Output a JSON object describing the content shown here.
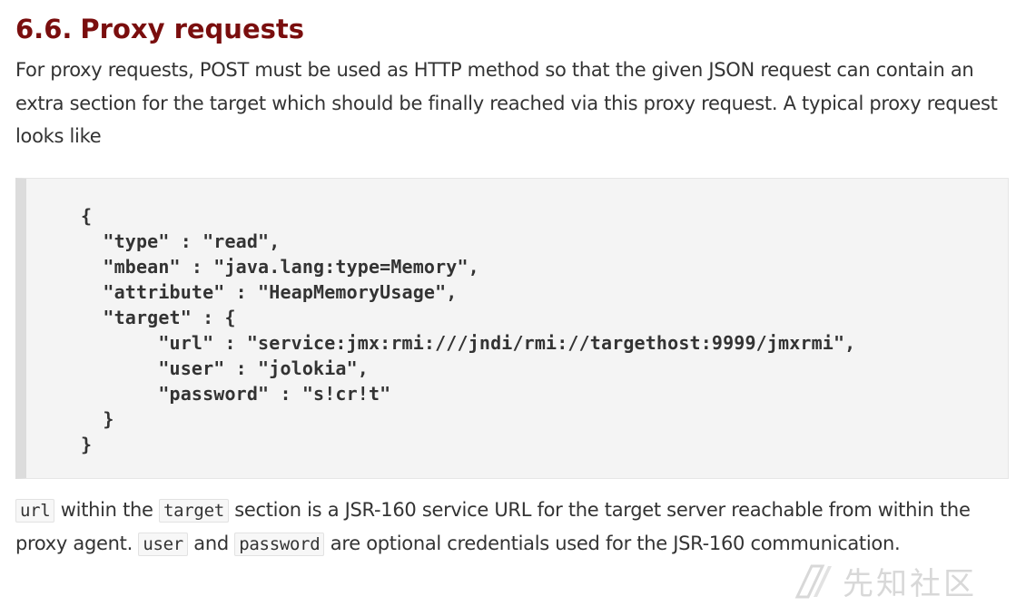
{
  "section": {
    "number": "6.6.",
    "title": "Proxy requests"
  },
  "intro": {
    "text": "For proxy requests, POST must be used as HTTP method so that the given JSON request can contain an extra section for the target which should be finally reached via this proxy request. A typical proxy request looks like"
  },
  "code_sample": {
    "lines": [
      "{",
      "  \"type\" : \"read\",",
      "  \"mbean\" : \"java.lang:type=Memory\",",
      "  \"attribute\" : \"HeapMemoryUsage\",",
      "  \"target\" : {",
      "       \"url\" : \"service:jmx:rmi:///jndi/rmi://targethost:9999/jmxrmi\",",
      "       \"user\" : \"jolokia\",",
      "       \"password\" : \"s!cr!t\"",
      "  }",
      "}"
    ]
  },
  "explanation": {
    "code_url": "url",
    "text1": " within the ",
    "code_target": "target",
    "text2": " section is a JSR-160 service URL for the target server reachable from within the proxy agent. ",
    "code_user": "user",
    "text3": " and ",
    "code_password": "password",
    "text4": " are optional credentials used for the JSR-160 communication."
  },
  "watermark": {
    "text": "先知社区",
    "icon": "xianzhi-logo-icon"
  }
}
